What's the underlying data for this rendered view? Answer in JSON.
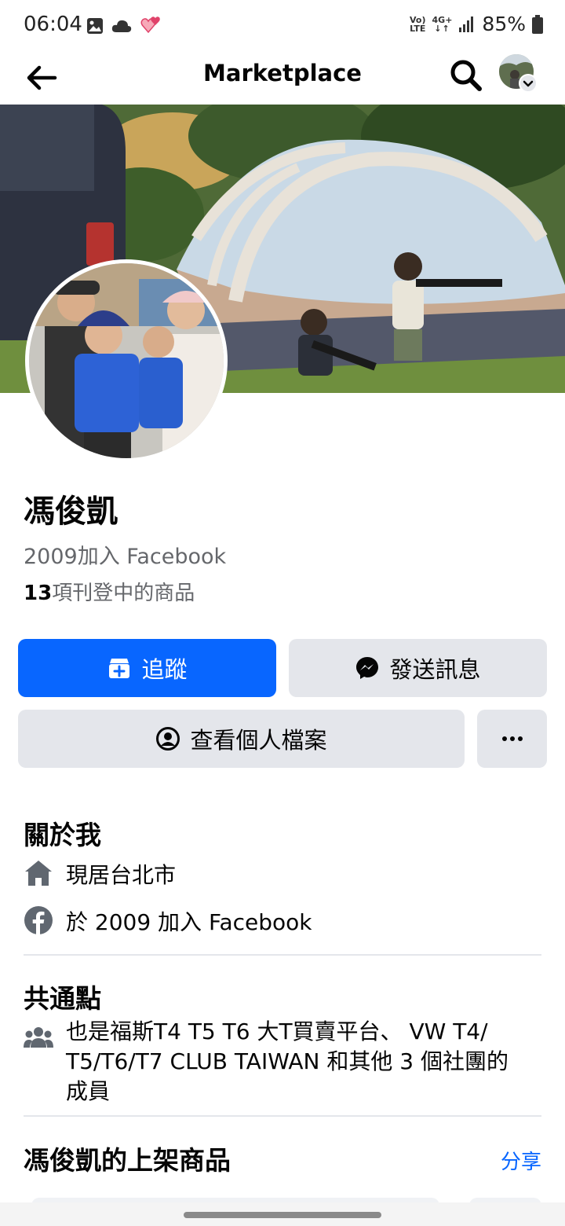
{
  "status_bar": {
    "time": "06:04",
    "net_top": "Vo)",
    "net_bottom": "LTE",
    "mobile_top": "4G+",
    "battery": "85%"
  },
  "app_bar": {
    "title": "Marketplace"
  },
  "profile": {
    "name": "馮俊凱",
    "joined": "2009加入 Facebook",
    "listing_count": "13",
    "listing_suffix": "項刊登中的商品"
  },
  "actions": {
    "follow": "追蹤",
    "message": "發送訊息",
    "view_profile": "查看個人檔案"
  },
  "about": {
    "title": "關於我",
    "lives_in": "現居台北市",
    "joined": "於 2009 加入 Facebook"
  },
  "mutual": {
    "title": "共通點",
    "text_line1": "也是福斯T4 T5 T6 大T買賣平台、 VW T4/",
    "text_line2": "T5/T6/T7 CLUB TAIWAN 和其他 3 個社團的",
    "text_line3": "成員"
  },
  "listings": {
    "title": "馮俊凱的上架商品",
    "share": "分享"
  },
  "colors": {
    "primary": "#0866ff",
    "secondary_bg": "#e4e6eb",
    "muted_text": "#65676b"
  }
}
